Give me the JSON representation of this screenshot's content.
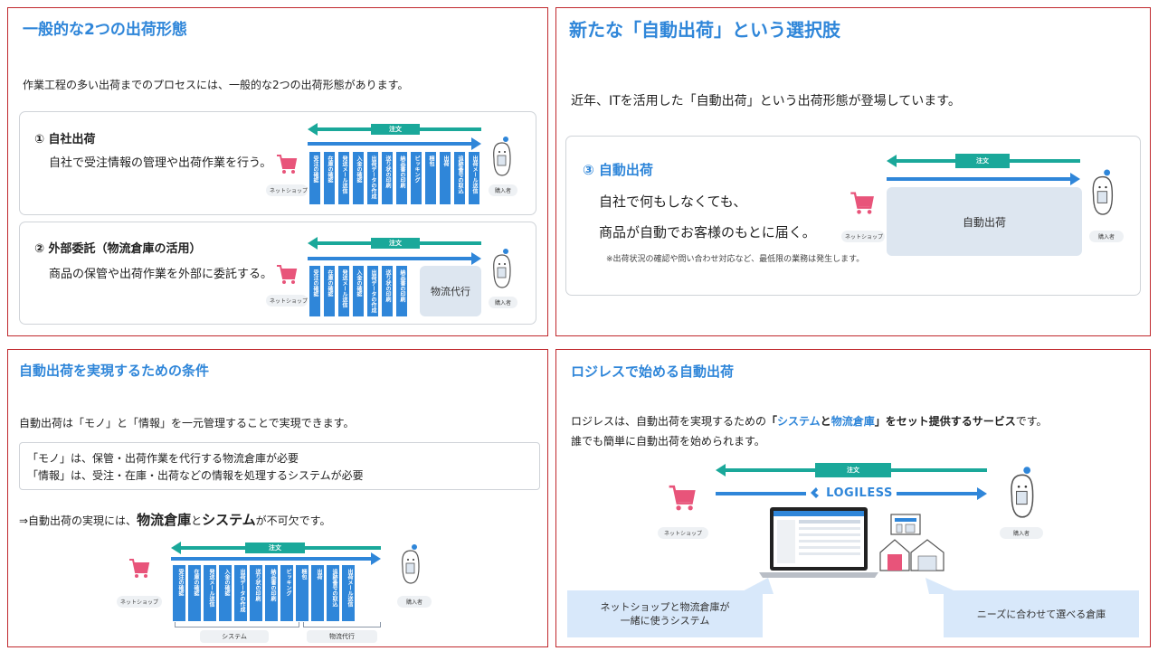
{
  "panel1": {
    "title": "一般的な2つの出荷形態",
    "intro": "作業工程の多い出荷までのプロセスには、一般的な2つの出荷形態があります。",
    "case1": {
      "heading": "① 自社出荷",
      "desc": "自社で受注情報の管理や出荷作業を行う。"
    },
    "case2": {
      "heading": "② 外部委託（物流倉庫の活用）",
      "desc": "商品の保管や出荷作業を外部に委託する。",
      "outsource_label": "物流代行"
    }
  },
  "panel2": {
    "title": "新たな「自動出荷」という選択肢",
    "intro": "近年、ITを活用した「自動出荷」という出荷形態が登場しています。",
    "case3": {
      "heading": "③ 自動出荷",
      "line1": "自社で何もしなくても、",
      "line2": "商品が自動でお客様のもとに届く。",
      "note": "※出荷状況の確認や問い合わせ対応など、最低限の業務は発生します。",
      "auto_label": "自動出荷"
    }
  },
  "panel3": {
    "title": "自動出荷を実現するための条件",
    "intro": "自動出荷は「モノ」と「情報」を一元管理することで実現できます。",
    "cond1": "「モノ」は、保管・出荷作業を代行する物流倉庫が必要",
    "cond2": "「情報」は、受注・在庫・出荷などの情報を処理するシステムが必要",
    "conclusion": {
      "prefix": "⇒自動出荷の実現には、",
      "w1": "物流倉庫",
      "mid": "と",
      "w2": "システム",
      "suffix": "が不可欠です。"
    },
    "system_label": "システム",
    "logistics_label": "物流代行"
  },
  "panel4": {
    "title": "ロジレスで始める自動出荷",
    "line1_prefix": "ロジレスは、自動出荷を実現するための",
    "line1_q1": "「",
    "line1_system": "システム",
    "line1_and": "と",
    "line1_warehouse": "物流倉庫",
    "line1_q2": "」をセット提供するサービス",
    "line1_suffix": "です。",
    "line2": "誰でも簡単に自動出荷を始められます。",
    "logo_text": "LOGILESS",
    "bubble_left": "ネットショップと物流倉庫が\n一緒に使うシステム",
    "bubble_left_1": "ネットショップと物流倉庫が",
    "bubble_left_2": "一緒に使うシステム",
    "bubble_right": "ニーズに合わせて選べる倉庫"
  },
  "common": {
    "order_label": "注文",
    "shop_label": "ネットショップ",
    "buyer_label": "購入者",
    "steps_full": [
      "受注の確認",
      "在庫の確認",
      "発送メール送信",
      "入金の確認",
      "出荷データの作成",
      "送り状の印刷",
      "納品書の印刷",
      "ピッキング",
      "梱包",
      "出荷",
      "追跡番号の取込",
      "出荷メール送信"
    ],
    "steps_partial": [
      "受注の確認",
      "在庫の確認",
      "発送メール送信",
      "入金の確認",
      "出荷データの作成",
      "送り状の印刷",
      "納品書の印刷"
    ],
    "steps_p3": [
      "受注の確認",
      "在庫の確認",
      "発送メール送信",
      "入金の確認",
      "出荷データの作成",
      "送り状の印刷",
      "納品書の印刷",
      "ピッキング",
      "梱包",
      "出荷",
      "追跡番号の取込",
      "出荷メール送信"
    ]
  },
  "colors": {
    "accent_blue": "#2f86d9",
    "accent_green": "#1aa89a",
    "border_red": "#c0282d",
    "cart_pink": "#e8547a"
  }
}
